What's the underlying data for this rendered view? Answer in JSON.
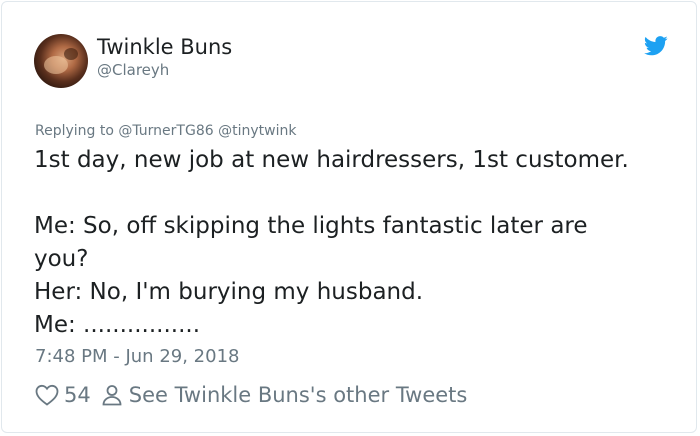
{
  "tweet": {
    "author_name": "Twinkle Buns",
    "author_handle": "@Clareyh",
    "replying_to": "Replying to @TurnerTG86 @tinytwink",
    "lines": [
      "1st day, new job at new hairdressers, 1st customer.",
      "",
      "Me: So, off skipping the lights fantastic later are",
      "you?",
      "Her: No, I'm burying my husband.",
      "Me: ................"
    ],
    "timestamp": "7:48 PM - Jun 29, 2018",
    "likes": "54",
    "other_tweets_label": "See Twinkle Buns's other Tweets"
  },
  "icons": {
    "brand": "twitter-bird-icon",
    "like": "heart-icon",
    "profile": "person-icon"
  },
  "colors": {
    "twitter_blue": "#1da1f2",
    "text_primary": "#1c2022",
    "text_secondary": "#697882",
    "border": "#e1e8ed"
  }
}
